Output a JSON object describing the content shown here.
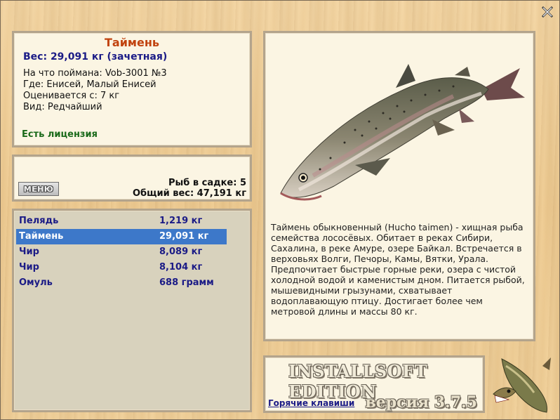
{
  "fish": {
    "title": "Таймень",
    "weight_line": "Вес: 29,091 кг (зачетная)",
    "bait_line": "На что поймана: Vob-3001 №3",
    "where_line": "Где: Енисей, Малый Енисей",
    "value_line": "Оценивается с: 7 кг",
    "kind_line": "Вид: Редчайший",
    "license": "Есть лицензия"
  },
  "keepnet": {
    "menu_label": "МЕНЮ",
    "count_line": "Рыб в садке: 5",
    "total_line": "Общий вес: 47,191 кг"
  },
  "catch_list": [
    {
      "name": "Пелядь",
      "weight": "1,219 кг",
      "selected": false
    },
    {
      "name": "Таймень",
      "weight": "29,091 кг",
      "selected": true
    },
    {
      "name": "Чир",
      "weight": "8,089 кг",
      "selected": false
    },
    {
      "name": "Чир",
      "weight": "8,104 кг",
      "selected": false
    },
    {
      "name": "Омуль",
      "weight": "688 грамм",
      "selected": false
    }
  ],
  "description": "Таймень обыкновенный (Hucho taimen) - хищная рыба семейства лососёвых. Обитает в реках Сибири, Сахалина, в реке Амуре, озере Байкал. Встречается в верховьях Волги, Печоры, Камы, Вятки, Урала. Предпочитает быстрые горные реки, озера с чистой холодной водой и каменистым дном. Питается рыбой, мышевидными грызунами, схватывает водоплавающую птицу. Достигает более чем метровой длины и массы 80 кг.",
  "logo": {
    "brand": "INSTALLSOFT EDITION",
    "version": "версия 3.7.5",
    "hotkeys": "Горячие клавиши"
  },
  "icons": {
    "close": "close-icon",
    "fish_image": "taimen-fish-image",
    "pike_logo": "pike-logo-icon"
  },
  "colors": {
    "title": "#c1430f",
    "accent_blue": "#1b1b86",
    "selection": "#3d78c9",
    "license_green": "#1a6a1a"
  }
}
